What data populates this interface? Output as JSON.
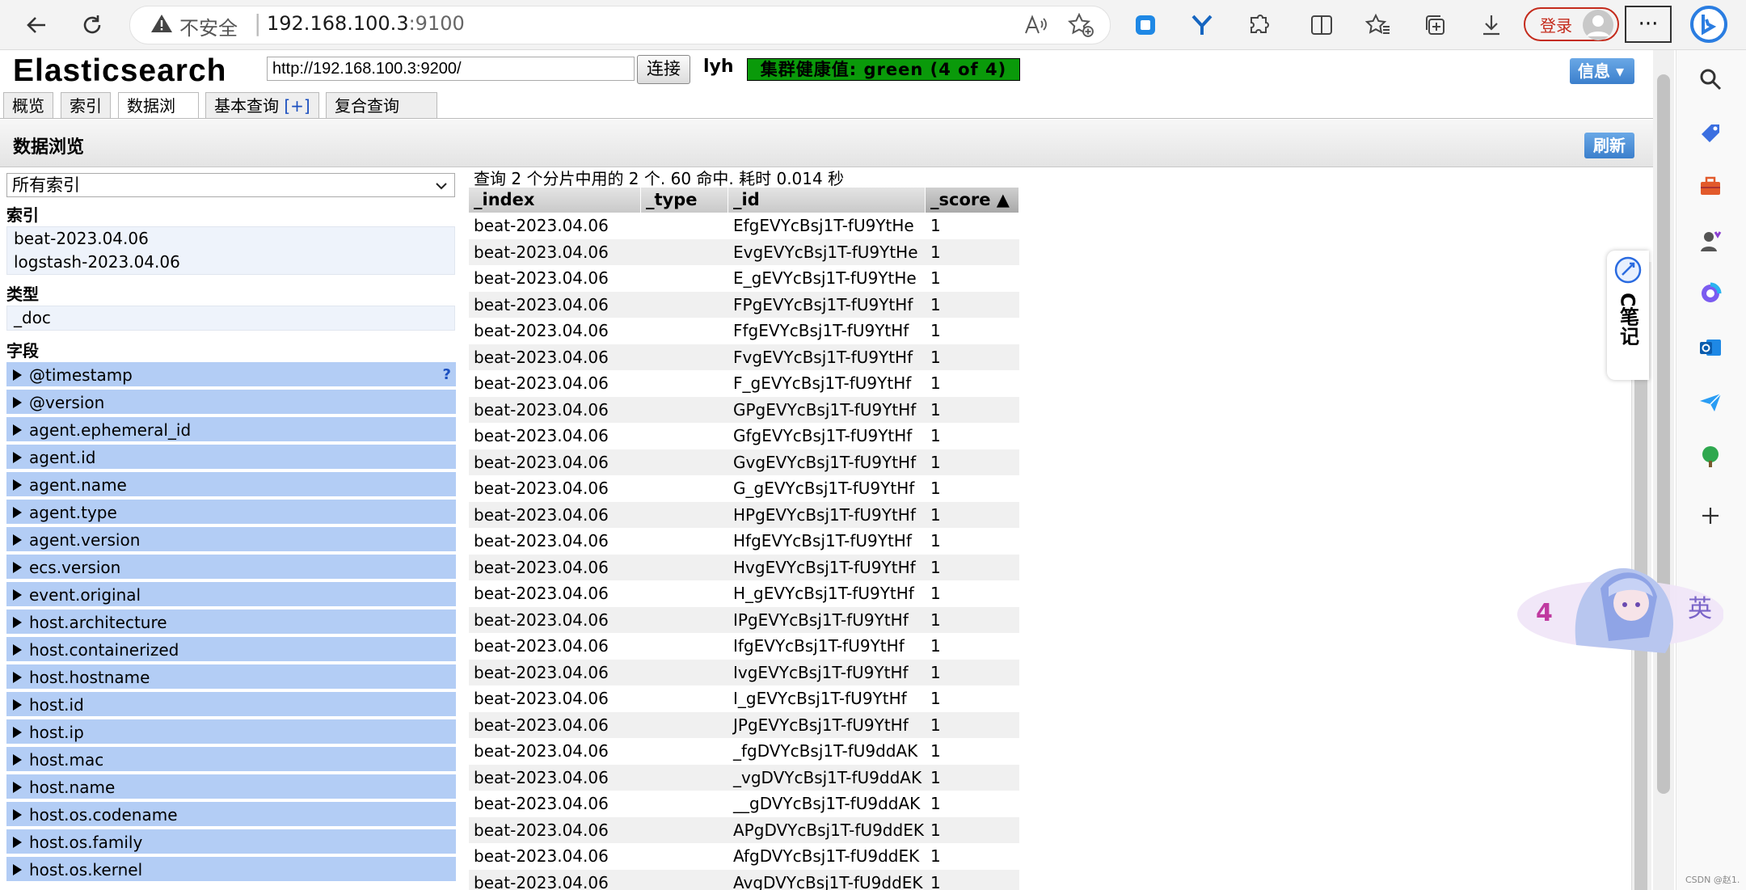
{
  "browser": {
    "security_label": "不安全",
    "url_host": "192.168.100.3",
    "url_port": ":9100",
    "login_label": "登录"
  },
  "app": {
    "title": "Elasticsearch",
    "url_value": "http://192.168.100.3:9200/",
    "connect_label": "连接",
    "cluster_name": "lyh",
    "health": "集群健康值: green (4 of 4)",
    "info_label": "信息 ▾",
    "tabs": [
      {
        "label": "概览"
      },
      {
        "label": "索引"
      },
      {
        "label": "数据浏览"
      },
      {
        "label": "基本查询",
        "plus": "[+]"
      },
      {
        "label": "复合查询",
        "plus": "[+]"
      }
    ],
    "active_tab": "数据浏览",
    "section_title": "数据浏览",
    "refresh_label": "刷新"
  },
  "left": {
    "index_select": "所有索引",
    "indices_heading": "索引",
    "indices": [
      "beat-2023.04.06",
      "logstash-2023.04.06"
    ],
    "types_heading": "类型",
    "types": [
      "_doc"
    ],
    "fields_heading": "字段",
    "fields": [
      "@timestamp",
      "@version",
      "agent.ephemeral_id",
      "agent.id",
      "agent.name",
      "agent.type",
      "agent.version",
      "ecs.version",
      "event.original",
      "host.architecture",
      "host.containerized",
      "host.hostname",
      "host.id",
      "host.ip",
      "host.mac",
      "host.name",
      "host.os.codename",
      "host.os.family",
      "host.os.kernel"
    ],
    "first_field_help": "?"
  },
  "results": {
    "summary": "查询 2 个分片中用的 2 个. 60 命中. 耗时 0.014 秒",
    "columns": [
      "_index",
      "_type",
      "_id",
      "_score ▲"
    ],
    "rows": [
      [
        "beat-2023.04.06",
        "",
        "EfgEVYcBsj1T-fU9YtHe",
        "1"
      ],
      [
        "beat-2023.04.06",
        "",
        "EvgEVYcBsj1T-fU9YtHe",
        "1"
      ],
      [
        "beat-2023.04.06",
        "",
        "E_gEVYcBsj1T-fU9YtHe",
        "1"
      ],
      [
        "beat-2023.04.06",
        "",
        "FPgEVYcBsj1T-fU9YtHf",
        "1"
      ],
      [
        "beat-2023.04.06",
        "",
        "FfgEVYcBsj1T-fU9YtHf",
        "1"
      ],
      [
        "beat-2023.04.06",
        "",
        "FvgEVYcBsj1T-fU9YtHf",
        "1"
      ],
      [
        "beat-2023.04.06",
        "",
        "F_gEVYcBsj1T-fU9YtHf",
        "1"
      ],
      [
        "beat-2023.04.06",
        "",
        "GPgEVYcBsj1T-fU9YtHf",
        "1"
      ],
      [
        "beat-2023.04.06",
        "",
        "GfgEVYcBsj1T-fU9YtHf",
        "1"
      ],
      [
        "beat-2023.04.06",
        "",
        "GvgEVYcBsj1T-fU9YtHf",
        "1"
      ],
      [
        "beat-2023.04.06",
        "",
        "G_gEVYcBsj1T-fU9YtHf",
        "1"
      ],
      [
        "beat-2023.04.06",
        "",
        "HPgEVYcBsj1T-fU9YtHf",
        "1"
      ],
      [
        "beat-2023.04.06",
        "",
        "HfgEVYcBsj1T-fU9YtHf",
        "1"
      ],
      [
        "beat-2023.04.06",
        "",
        "HvgEVYcBsj1T-fU9YtHf",
        "1"
      ],
      [
        "beat-2023.04.06",
        "",
        "H_gEVYcBsj1T-fU9YtHf",
        "1"
      ],
      [
        "beat-2023.04.06",
        "",
        "IPgEVYcBsj1T-fU9YtHf",
        "1"
      ],
      [
        "beat-2023.04.06",
        "",
        "IfgEVYcBsj1T-fU9YtHf",
        "1"
      ],
      [
        "beat-2023.04.06",
        "",
        "IvgEVYcBsj1T-fU9YtHf",
        "1"
      ],
      [
        "beat-2023.04.06",
        "",
        "I_gEVYcBsj1T-fU9YtHf",
        "1"
      ],
      [
        "beat-2023.04.06",
        "",
        "JPgEVYcBsj1T-fU9YtHf",
        "1"
      ],
      [
        "beat-2023.04.06",
        "",
        "_fgDVYcBsj1T-fU9ddAK",
        "1"
      ],
      [
        "beat-2023.04.06",
        "",
        "_vgDVYcBsj1T-fU9ddAK",
        "1"
      ],
      [
        "beat-2023.04.06",
        "",
        "__gDVYcBsj1T-fU9ddAK",
        "1"
      ],
      [
        "beat-2023.04.06",
        "",
        "APgDVYcBsj1T-fU9ddEK",
        "1"
      ],
      [
        "beat-2023.04.06",
        "",
        "AfgDVYcBsj1T-fU9ddEK",
        "1"
      ],
      [
        "beat-2023.04.06",
        "",
        "AvgDVYcBsj1T-fU9ddEK",
        "1"
      ]
    ]
  },
  "widgets": {
    "note_label": "C笔记",
    "deco_text": "英",
    "watermark": "CSDN @赵1."
  },
  "colors": {
    "health_green": "#0a9a0a",
    "field_blue": "#b3cdf5",
    "button_blue": "#3b7fcc",
    "login_red": "#c42b1c"
  },
  "icons": [
    "back-icon",
    "refresh-icon",
    "warning-icon",
    "read-aloud-icon",
    "favorite-add-icon",
    "extension-icon",
    "split-screen-icon",
    "favorites-icon",
    "collections-icon",
    "download-icon",
    "more-icon",
    "bing-icon",
    "search-icon",
    "tag-icon",
    "toolbox-icon",
    "games-icon",
    "copilot-icon",
    "outlook-icon",
    "send-icon",
    "tree-icon",
    "add-icon"
  ]
}
